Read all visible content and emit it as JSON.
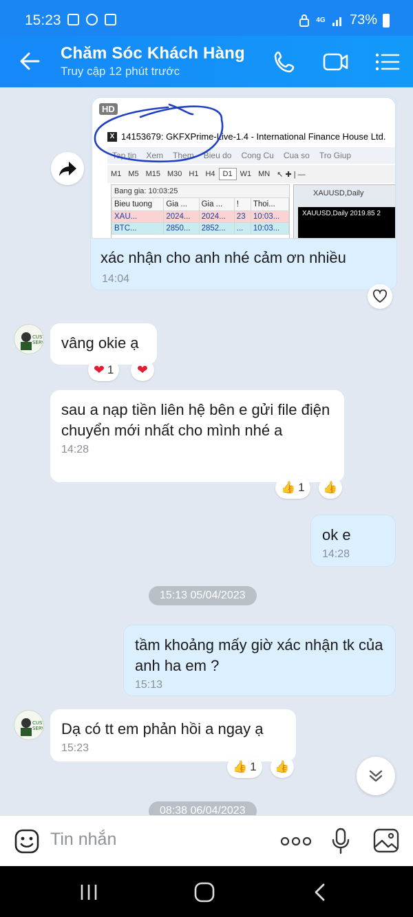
{
  "status_bar": {
    "time": "15:23",
    "network": "4G",
    "battery": "73%"
  },
  "header": {
    "title": "Chăm Sóc Khách Hàng",
    "subtitle": "Truy cập 12 phút trước"
  },
  "screenshot": {
    "hd_badge": "HD",
    "window_title": "14153679: GKFXPrime-Live-1.4 - International Finance House Ltd.",
    "menu": [
      "Tap tin",
      "Xem",
      "Them",
      "Bieu do",
      "Cong Cu",
      "Cua so",
      "Tro Giup"
    ],
    "timeframes": [
      "M1",
      "M5",
      "M15",
      "M30",
      "H1",
      "H4",
      "D1",
      "W1",
      "MN"
    ],
    "selected_timeframe": "D1",
    "panel_title": "Bang gia: 10:03:25",
    "table_headers": [
      "Bieu tuong",
      "Gia ...",
      "Gia ...",
      "!",
      "Thoi..."
    ],
    "rows": [
      [
        "XAU...",
        "2024...",
        "2024...",
        "23",
        "10:03..."
      ],
      [
        "BTC...",
        "2850...",
        "2852...",
        "...",
        "10:03..."
      ]
    ],
    "chart_tab": "XAUUSD,Daily",
    "chart_header": "XAUUSD,Daily  2019.85 2"
  },
  "messages": [
    {
      "side": "out",
      "text": "xác nhận cho anh nhé cảm ơn nhiều",
      "time": "14:04"
    },
    {
      "side": "in",
      "text": "vâng okie ạ",
      "time": "",
      "reaction_count": "1"
    },
    {
      "side": "in",
      "text": "sau a nạp tiền liên hệ bên e gửi file điện chuyển mới nhất cho mình nhé a",
      "time": "14:28",
      "reaction_count": "1"
    },
    {
      "side": "out",
      "text": "ok e",
      "time": "14:28"
    },
    {
      "side": "out",
      "text": "tầm khoảng mấy giờ xác nhận tk của anh ha em ?",
      "time": "15:13"
    },
    {
      "side": "in",
      "text": "Dạ có tt em phản hồi a ngay ạ",
      "time": "15:23",
      "reaction_count": "1"
    }
  ],
  "date_separators": [
    "15:13 05/04/2023",
    "08:38 06/04/2023"
  ],
  "input": {
    "placeholder": "Tin nhắn"
  },
  "colors": {
    "header": "#1a86f3",
    "incoming_bubble": "#ffffff",
    "outgoing_bubble": "#dcefff",
    "background": "#e2e8f1"
  }
}
